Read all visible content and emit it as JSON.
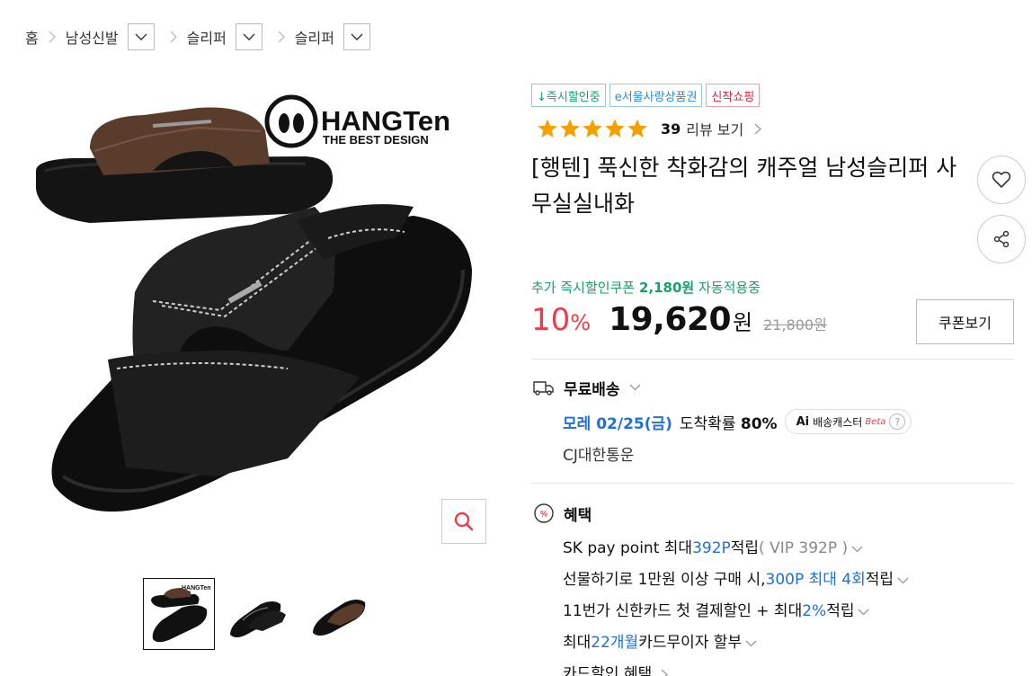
{
  "breadcrumb": {
    "home": "홈",
    "level1": "남성신발",
    "level2": "슬리퍼",
    "level3": "슬리퍼"
  },
  "product_image": {
    "brand_logo_text": "HANGTen",
    "brand_tagline": "THE BEST DESIGN",
    "thumbnail_count": 3
  },
  "badges": [
    "↓즉시할인중",
    "e서울사랑상품권",
    "신작쇼핑"
  ],
  "rating": {
    "stars": 5,
    "count": "39",
    "label": "리뷰 보기"
  },
  "title": "[행텐] 푹신한 착화감의 캐주얼 남성슬리퍼 사무실실내화",
  "coupon": {
    "prefix": "추가 즉시할인쿠폰",
    "amount": "2,180원",
    "suffix": "자동적용중"
  },
  "price": {
    "discount": "10",
    "discount_unit": "%",
    "current": "19,620",
    "currency": "원",
    "original": "21,800원"
  },
  "coupon_button": "쿠폰보기",
  "shipping": {
    "title": "무료배송",
    "date": "모레 02/25(금)",
    "probability_label": "도착확률",
    "probability_value": "80%",
    "ai_label": "Ai",
    "ai_text": "배송캐스터",
    "beta": "Beta",
    "help": "?",
    "carrier": "CJ대한통운"
  },
  "benefits": {
    "title": "혜택",
    "items": [
      {
        "a": "SK pay point 최대 ",
        "b": "392P",
        "c": " 적립",
        "d": "( VIP 392P )"
      },
      {
        "a": "선물하기로 1만원 이상 구매 시, ",
        "b": "300P 최대 4회",
        "c": " 적립",
        "d": ""
      },
      {
        "a": "11번가 신한카드 첫 결제할인 + 최대 ",
        "b": "2%",
        "c": " 적립",
        "d": ""
      },
      {
        "a": "최대 ",
        "b": "22개월",
        "c": " 카드무이자 할부",
        "d": ""
      },
      {
        "a": "카드할인 혜택",
        "b": "",
        "c": "",
        "d": ""
      }
    ]
  },
  "colors": {
    "accent_red": "#f23a4a",
    "accent_green": "#14a36a",
    "accent_blue": "#1f6fe0",
    "star": "#f5a000"
  }
}
